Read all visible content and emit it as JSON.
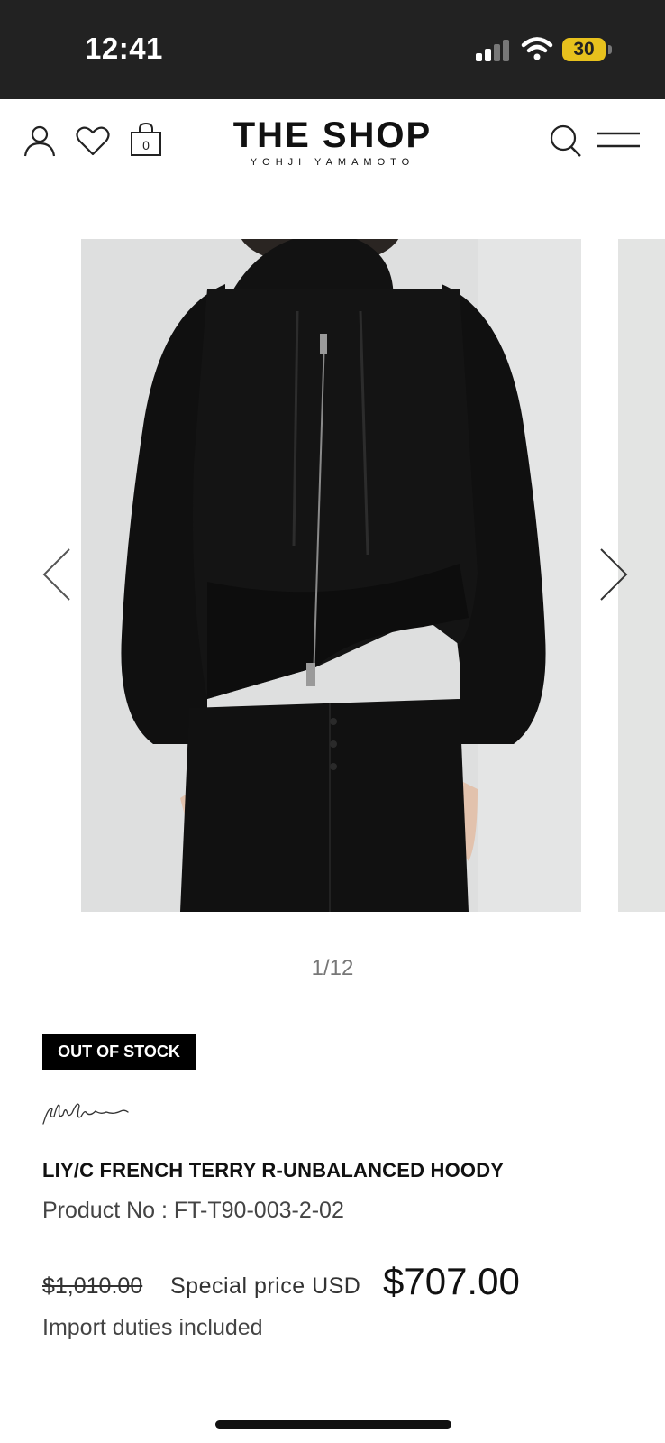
{
  "status_bar": {
    "time": "12:41",
    "battery": "30"
  },
  "header": {
    "logo_main": "THE SHOP",
    "logo_sub": "YOHJI YAMAMOTO",
    "cart_count": "0"
  },
  "gallery": {
    "counter": "1/12"
  },
  "product": {
    "badge": "OUT OF STOCK",
    "brand_signature": "Yohji Yamamoto",
    "name": "LIY/C FRENCH TERRY R-UNBALANCED HOODY",
    "product_no": "Product No : FT-T90-003-2-02",
    "old_price": "$1,010.00",
    "special_label": "Special price USD",
    "special_price": "$707.00",
    "duties": "Import duties included"
  },
  "icons": [
    "user-icon",
    "heart-icon",
    "bag-icon",
    "search-icon",
    "menu-icon",
    "chevron-left-icon",
    "chevron-right-icon"
  ]
}
